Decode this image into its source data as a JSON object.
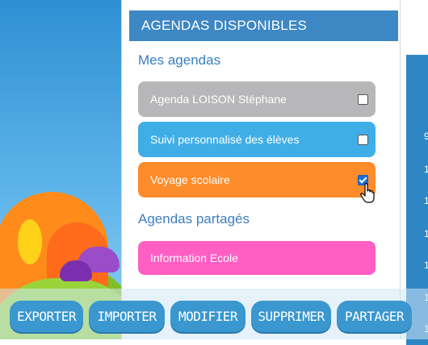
{
  "header": {
    "title": "AGENDAS DISPONIBLES"
  },
  "sections": {
    "mine": {
      "title": "Mes agendas"
    },
    "shared": {
      "title": "Agendas partagés"
    }
  },
  "agendas": [
    {
      "label": "Agenda LOISON Stéphane",
      "color": "#b7b7b9",
      "checked": false
    },
    {
      "label": "Suivi personnalisé des élèves",
      "color": "#40aee6",
      "checked": false
    },
    {
      "label": "Voyage scolaire",
      "color": "#ff8c2b",
      "checked": true
    },
    {
      "label": "Information Ecole",
      "color": "#ff5ec3"
    }
  ],
  "right_digits": [
    "9",
    "1",
    "1",
    "1",
    "1",
    "1",
    "1"
  ],
  "toolbar": {
    "export_label": "EXPORTER",
    "import_label": "IMPORTER",
    "modify_label": "MODIFIER",
    "delete_label": "SUPPRIMER",
    "share_label": "PARTAGER"
  },
  "colors": {
    "header": "#3c87c4",
    "section_title": "#3a7fc0",
    "button": "#3a97cf"
  }
}
